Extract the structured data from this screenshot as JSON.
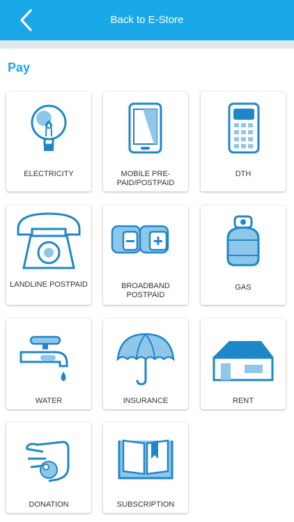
{
  "header": {
    "title": "Back to E-Store",
    "back_icon": "chevron-left-icon",
    "background": "#1aa9e8"
  },
  "section": {
    "title": "Pay"
  },
  "accent": "#1aa9e8",
  "tiles": [
    {
      "label": "ELECTRICITY",
      "icon": "lightbulb-icon"
    },
    {
      "label": "MOBILE PRE-PAID/POSTPAID",
      "icon": "mobile-phone-icon"
    },
    {
      "label": "DTH",
      "icon": "remote-control-icon"
    },
    {
      "label": "LANDLINE POSTPAID",
      "icon": "telephone-icon"
    },
    {
      "label": "BROADBAND POSTPAID",
      "icon": "battery-icon"
    },
    {
      "label": "GAS",
      "icon": "gas-cylinder-icon"
    },
    {
      "label": "WATER",
      "icon": "water-tap-icon"
    },
    {
      "label": "INSURANCE",
      "icon": "umbrella-icon"
    },
    {
      "label": "RENT",
      "icon": "house-icon"
    },
    {
      "label": "DONATION",
      "icon": "donation-hand-icon"
    },
    {
      "label": "SUBSCRIPTION",
      "icon": "open-book-icon"
    }
  ]
}
